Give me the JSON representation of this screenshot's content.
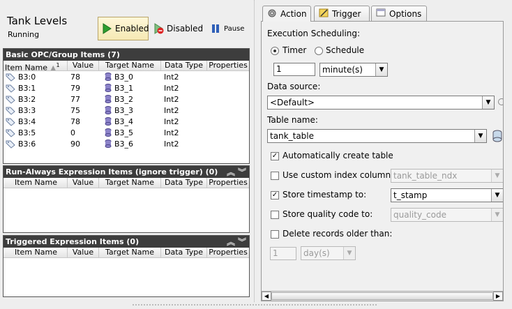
{
  "header": {
    "title": "Tank Levels",
    "status": "Running",
    "enabled_label": "Enabled",
    "disabled_label": "Disabled",
    "pause_label": "Pause"
  },
  "basic_panel": {
    "title": "Basic OPC/Group Items (7)",
    "columns": [
      "Item Name",
      "Value",
      "Target Name",
      "Data Type",
      "Properties"
    ],
    "sort_indicator": "1",
    "rows": [
      {
        "item": "B3:0",
        "value": "78",
        "target": "B3_0",
        "type": "Int2"
      },
      {
        "item": "B3:1",
        "value": "79",
        "target": "B3_1",
        "type": "Int2"
      },
      {
        "item": "B3:2",
        "value": "77",
        "target": "B3_2",
        "type": "Int2"
      },
      {
        "item": "B3:3",
        "value": "75",
        "target": "B3_3",
        "type": "Int2"
      },
      {
        "item": "B3:4",
        "value": "78",
        "target": "B3_4",
        "type": "Int2"
      },
      {
        "item": "B3:5",
        "value": "0",
        "target": "B3_5",
        "type": "Int2"
      },
      {
        "item": "B3:6",
        "value": "90",
        "target": "B3_6",
        "type": "Int2"
      }
    ]
  },
  "run_always_panel": {
    "title": "Run-Always Expression Items (ignore trigger) (0)",
    "columns": [
      "Item Name",
      "Value",
      "Target Name",
      "Data Type",
      "Properties"
    ]
  },
  "triggered_panel": {
    "title": "Triggered Expression Items (0)",
    "columns": [
      "Item Name",
      "Value",
      "Target Name",
      "Data Type",
      "Properties"
    ]
  },
  "tabs": [
    "Action",
    "Trigger",
    "Options"
  ],
  "action": {
    "scheduling_label": "Execution Scheduling:",
    "timer_label": "Timer",
    "schedule_label": "Schedule",
    "rate_value": "1",
    "rate_unit": "minute(s)",
    "datasource_label": "Data source:",
    "datasource_value": "<Default>",
    "table_label": "Table name:",
    "table_value": "tank_table",
    "auto_create_label": "Automatically create table",
    "custom_index_label": "Use custom index column:",
    "custom_index_value": "tank_table_ndx",
    "store_timestamp_label": "Store timestamp to:",
    "timestamp_value": "t_stamp",
    "store_quality_label": "Store quality code to:",
    "quality_value": "quality_code",
    "delete_label": "Delete records older than:",
    "delete_value": "1",
    "delete_unit": "day(s)"
  },
  "colors": {
    "panel_header": "#3d3d3d",
    "enabled_bg": "#f6e9b4",
    "db_icon": "#8c83c9"
  }
}
